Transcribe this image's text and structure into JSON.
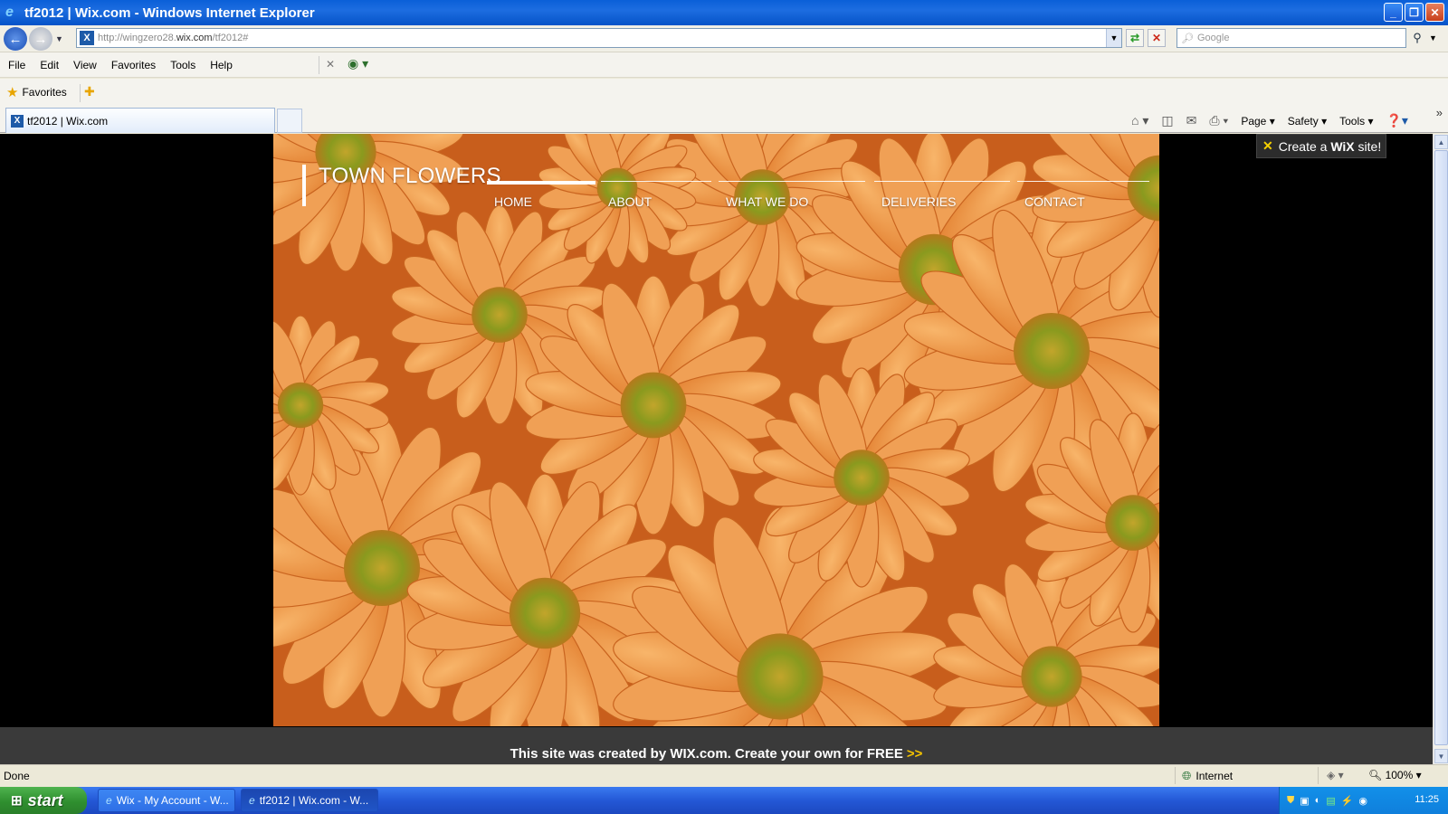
{
  "window": {
    "title": "tf2012 | Wix.com - Windows Internet Explorer",
    "min_icon": "minimize-icon",
    "max_icon": "maximize-icon",
    "close_icon": "close-icon"
  },
  "navbar": {
    "address_url_prefix": "http://wingzero28.",
    "address_url_domain": "wix.com",
    "address_url_suffix": "/tf2012#",
    "search_placeholder": "Google"
  },
  "menubar": {
    "items": [
      "File",
      "Edit",
      "View",
      "Favorites",
      "Tools",
      "Help"
    ]
  },
  "favorites": {
    "label": "Favorites"
  },
  "tabs": [
    {
      "label": "tf2012 | Wix.com"
    }
  ],
  "commandbar": {
    "page": "Page",
    "safety": "Safety",
    "tools": "Tools"
  },
  "site": {
    "brand": "TOWN FLOWERS",
    "nav": [
      "HOME",
      "ABOUT",
      "WHAT WE DO",
      "DELIVERIES",
      "CONTACT"
    ],
    "active_nav": "HOME",
    "wix_badge_prefix": "Create a",
    "wix_badge_brand": "WiX",
    "wix_badge_suffix": "site!",
    "footer_text": "This site was created by WIX.com. Create your own for FREE",
    "footer_arrow": ">>"
  },
  "statusbar": {
    "status": "Done",
    "zone": "Internet",
    "zoom": "100%"
  },
  "taskbar": {
    "start": "start",
    "tasks": [
      {
        "label": "Wix - My Account - W..."
      },
      {
        "label": "tf2012 | Wix.com - W..."
      }
    ],
    "clock": "11:25"
  },
  "colors": {
    "titlebar": "#0a5fd8",
    "hero_base": "#d86a22",
    "petal": "#f2a253",
    "flower_center": "#8a9a1e",
    "footer_bg": "#3a3a3a",
    "footer_arrow": "#f5c400",
    "wix_mark": "#f5d000"
  }
}
